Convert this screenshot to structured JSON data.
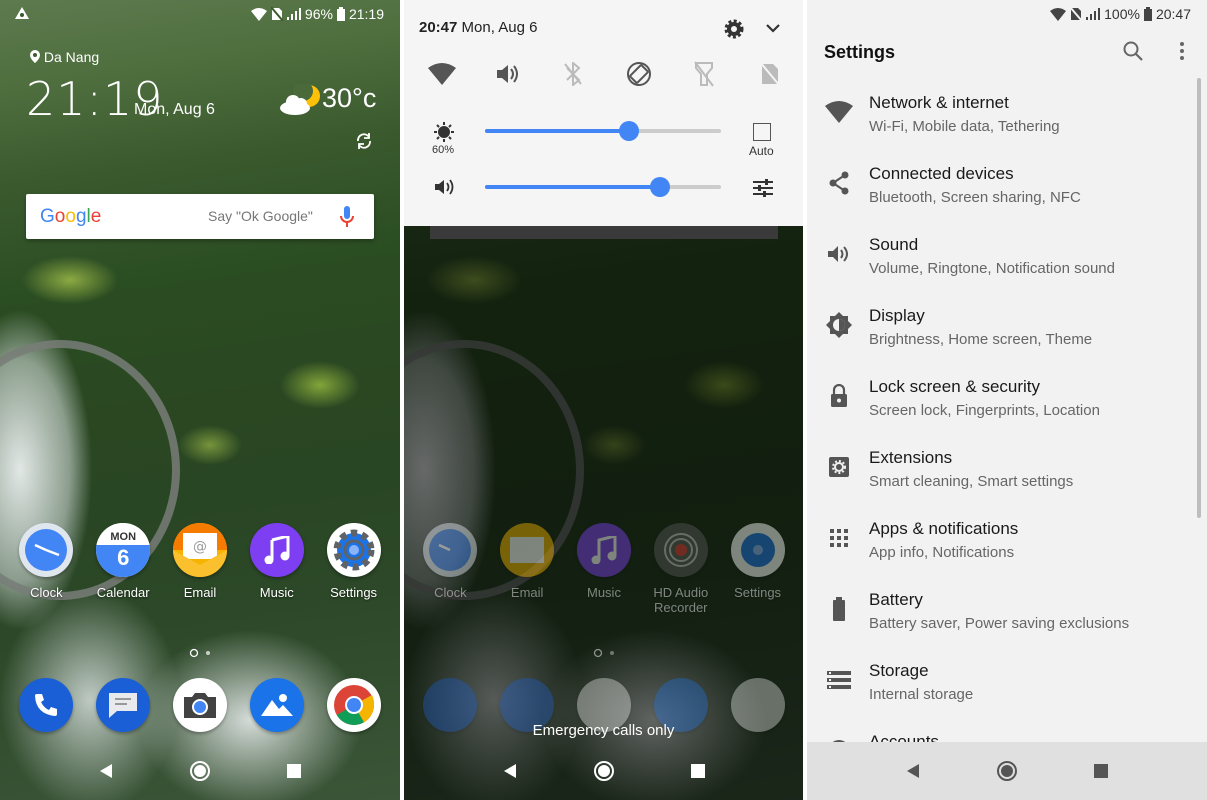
{
  "home": {
    "status": {
      "battery": "96%",
      "time": "21:19"
    },
    "location": "Da Nang",
    "time": "21:19",
    "date": "Mon, Aug 6",
    "temperature": "30°c",
    "search_logo": "Google",
    "search_placeholder": "Say \"Ok Google\"",
    "apps": [
      {
        "label": "Clock",
        "icon": "clock-icon"
      },
      {
        "label": "Calendar",
        "icon": "calendar-icon",
        "badge_day": "MON",
        "badge_num": "6"
      },
      {
        "label": "Email",
        "icon": "email-icon",
        "at": "@"
      },
      {
        "label": "Music",
        "icon": "music-icon"
      },
      {
        "label": "Settings",
        "icon": "settings-icon"
      }
    ],
    "dock": [
      "phone-icon",
      "messages-icon",
      "camera-icon",
      "photos-icon",
      "chrome-icon"
    ]
  },
  "quick_settings": {
    "time": "20:47",
    "date": "Mon, Aug 6",
    "tiles": [
      "wifi-icon",
      "volume-icon",
      "bluetooth-off-icon",
      "auto-rotate-icon",
      "flashlight-off-icon",
      "sim-off-icon"
    ],
    "brightness_pct_label": "60%",
    "brightness_level": 0.61,
    "auto_label": "Auto",
    "volume_level": 0.74,
    "apps": [
      {
        "label": "Clock"
      },
      {
        "label": "Email"
      },
      {
        "label": "Music"
      },
      {
        "label": "HD Audio Recorder"
      },
      {
        "label": "Settings"
      }
    ],
    "emergency": "Emergency calls only"
  },
  "settings": {
    "status": {
      "battery": "100%",
      "time": "20:47"
    },
    "title": "Settings",
    "items": [
      {
        "title": "Network & internet",
        "subtitle": "Wi-Fi, Mobile data, Tethering",
        "icon": "wifi-icon"
      },
      {
        "title": "Connected devices",
        "subtitle": "Bluetooth, Screen sharing, NFC",
        "icon": "share-icon"
      },
      {
        "title": "Sound",
        "subtitle": "Volume, Ringtone, Notification sound",
        "icon": "volume-icon"
      },
      {
        "title": "Display",
        "subtitle": "Brightness, Home screen, Theme",
        "icon": "brightness-icon"
      },
      {
        "title": "Lock screen & security",
        "subtitle": "Screen lock, Fingerprints, Location",
        "icon": "lock-icon"
      },
      {
        "title": "Extensions",
        "subtitle": "Smart cleaning, Smart settings",
        "icon": "extensions-icon"
      },
      {
        "title": "Apps & notifications",
        "subtitle": "App info, Notifications",
        "icon": "apps-grid-icon"
      },
      {
        "title": "Battery",
        "subtitle": "Battery saver, Power saving exclusions",
        "icon": "battery-icon"
      },
      {
        "title": "Storage",
        "subtitle": "Internal storage",
        "icon": "storage-icon"
      },
      {
        "title": "Accounts",
        "subtitle": "",
        "icon": "account-icon"
      }
    ]
  }
}
